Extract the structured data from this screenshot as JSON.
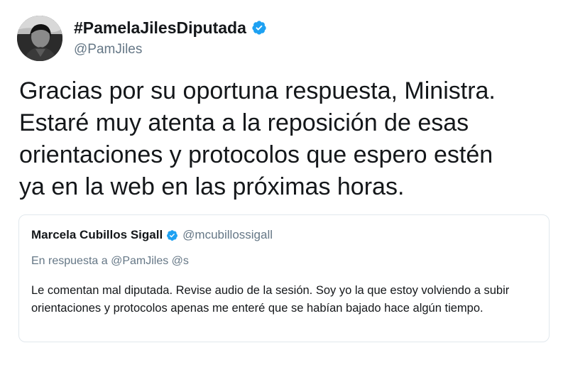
{
  "tweet": {
    "author": {
      "display_name": "#PamelaJilesDiputada",
      "handle": "@PamJiles",
      "verified": true
    },
    "text": "Gracias por su oportuna respuesta, Ministra.\nEstaré muy atenta a la reposición de esas\norientaciones y protocolos que espero estén\nya en la web en las próximas horas.",
    "quoted_tweet": {
      "author": {
        "display_name": "Marcela Cubillos Sigall",
        "handle": "@mcubillossigall",
        "verified": true
      },
      "reply_context": "En respuesta a @PamJiles @s",
      "text": "Le comentan mal diputada. Revise audio de la sesión. Soy yo la que estoy volviendo a subir orientaciones y protocolos apenas me enteré que se habían bajado hace algún tiempo."
    }
  },
  "colors": {
    "verified_badge": "#1da1f2",
    "text_primary": "#14171a",
    "text_secondary": "#657786",
    "border": "#e1e8ed"
  },
  "icons": {
    "author_verified": "verified-badge-icon",
    "quoted_verified": "verified-badge-icon"
  }
}
